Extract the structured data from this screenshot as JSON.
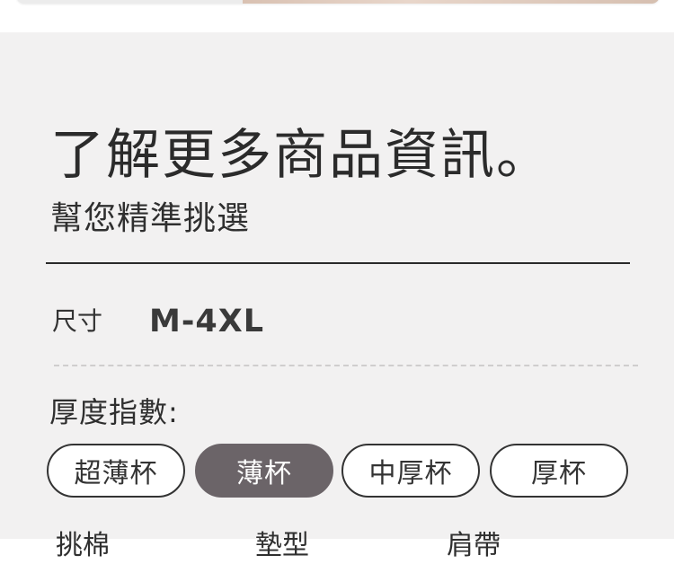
{
  "header": {
    "title": "了解更多商品資訊。",
    "subtitle": "幫您精準挑選"
  },
  "size": {
    "label": "尺寸",
    "value": "M-4XL"
  },
  "thickness": {
    "label": "厚度指數:",
    "options": [
      {
        "label": "超薄杯",
        "selected": false
      },
      {
        "label": "薄杯",
        "selected": true
      },
      {
        "label": "中厚杯",
        "selected": false
      },
      {
        "label": "厚杯",
        "selected": false
      }
    ]
  },
  "next_section": {
    "items": [
      "挑棉",
      "墊型",
      "肩帶"
    ]
  },
  "colors": {
    "panel_bg": "#f2f1f1",
    "selected_chip": "#6b6468",
    "chip_border": "#333333"
  }
}
